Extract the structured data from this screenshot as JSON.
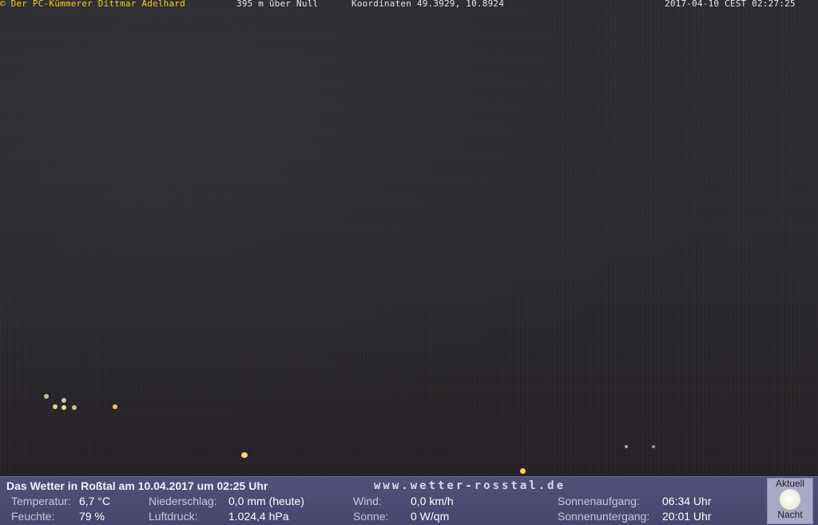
{
  "header": {
    "copyright": "© Der PC-Kümmerer Dittmar Adelhard",
    "altitude": "395 m über Null",
    "coordinates": "Koordinaten 49.3929, 10.8924",
    "timestamp": "2017-04-10 CEST 02:27:25"
  },
  "weather_bar": {
    "title": "Das Wetter in Roßtal am 10.04.2017 um 02:25 Uhr",
    "website": "www.wetter-rosstal.de",
    "temperature_label": "Temperatur:",
    "temperature_value": "6,7 °C",
    "humidity_label": "Feuchte:",
    "humidity_value": "79 %",
    "precip_label": "Niederschlag:",
    "precip_value": "0,0 mm (heute)",
    "pressure_label": "Luftdruck:",
    "pressure_value": "1.024,4 hPa",
    "wind_label": "Wind:",
    "wind_value": "0,0 km/h",
    "sun_label": "Sonne:",
    "sun_value": "0 W/qm",
    "sunrise_label": "Sonnenaufgang:",
    "sunrise_value": "06:34 Uhr",
    "sunset_label": "Sonnenuntergang:",
    "sunset_value": "20:01 Uhr"
  },
  "status_badge": {
    "top_label": "Aktuell",
    "bottom_label": "Nacht",
    "icon": "moon-icon"
  },
  "colors": {
    "header_yellow": "#f4d31c",
    "bar_background": "#4a4a74"
  }
}
